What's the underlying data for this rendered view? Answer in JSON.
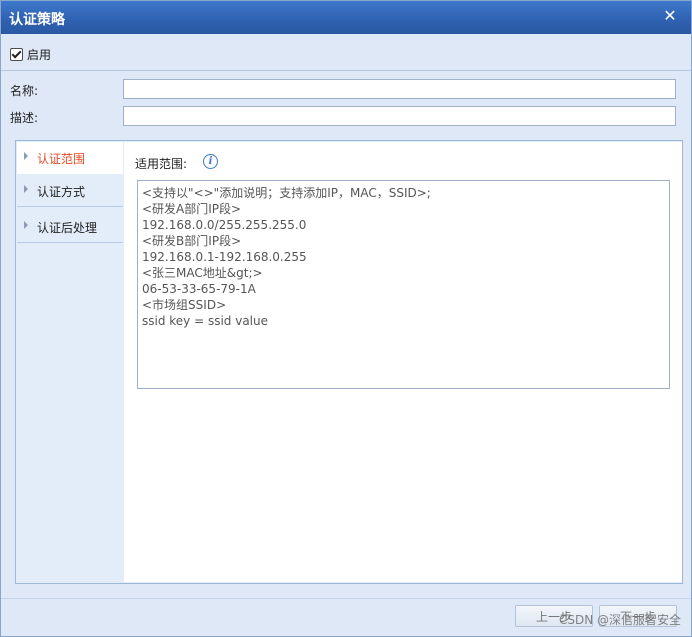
{
  "window": {
    "title": "认证策略",
    "close_glyph": "✕"
  },
  "enable": {
    "label": "启用",
    "checked": true
  },
  "form": {
    "name_label": "名称:",
    "name_value": "",
    "desc_label": "描述:",
    "desc_value": ""
  },
  "tabs": [
    {
      "label": "认证范围",
      "active": true
    },
    {
      "label": "认证方式",
      "active": false
    },
    {
      "label": "认证后处理",
      "active": false
    }
  ],
  "scope": {
    "label": "适用范围:",
    "info_icon": "info-icon",
    "lines": [
      "<支持以\"<>\"添加说明；支持添加IP，MAC，SSID>;",
      "<研发A部门IP段>",
      "192.168.0.0/255.255.255.0",
      "<研发B部门IP段>",
      "192.168.0.1-192.168.0.255",
      "<张三MAC地址&gt;>",
      "06-53-33-65-79-1A",
      "<市场组SSID>",
      "ssid key = ssid value"
    ]
  },
  "buttons": {
    "prev": "上一步",
    "next": "下一步"
  },
  "watermark": "CSDN @深信服智安全"
}
